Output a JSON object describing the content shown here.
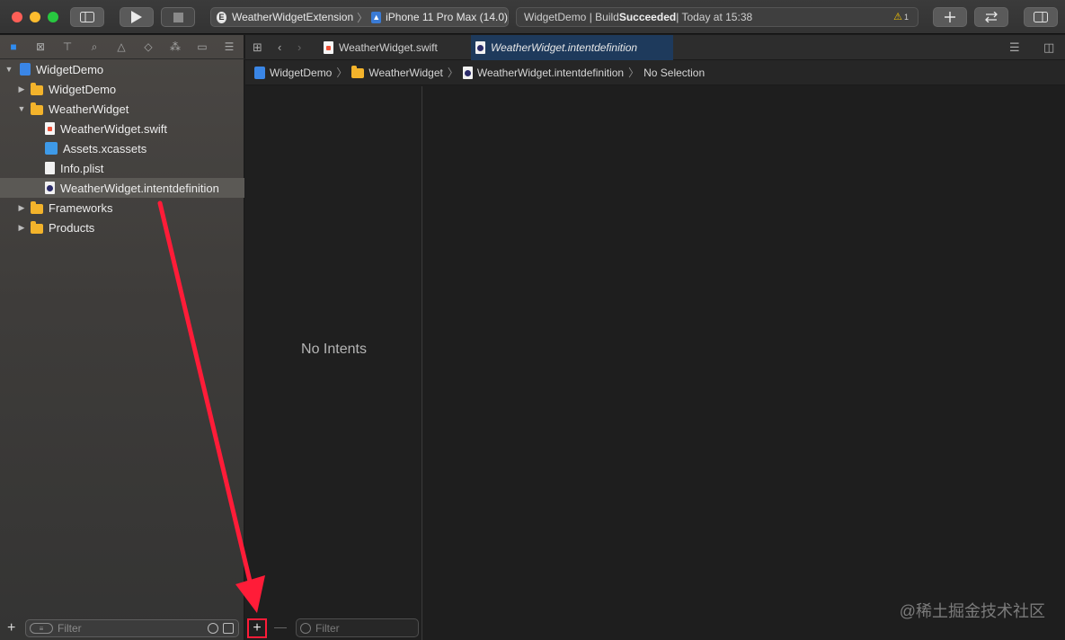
{
  "toolbar": {
    "scheme_target": "WeatherWidgetExtension",
    "scheme_badge": "E",
    "device": "iPhone 11 Pro Max (14.0)",
    "status_prefix": "WidgetDemo | Build ",
    "status_bold": "Succeeded",
    "status_suffix": " | Today at 15:38",
    "warning_count": "1"
  },
  "navigator": {
    "tree": [
      {
        "label": "WidgetDemo",
        "icon": "project-icon",
        "indent": 0,
        "expanded": true
      },
      {
        "label": "WidgetDemo",
        "icon": "folder-icon",
        "indent": 1,
        "expanded": false
      },
      {
        "label": "WeatherWidget",
        "icon": "folder-icon",
        "indent": 1,
        "expanded": true
      },
      {
        "label": "WeatherWidget.swift",
        "icon": "swift-file-icon",
        "indent": 2
      },
      {
        "label": "Assets.xcassets",
        "icon": "asset-catalog-icon",
        "indent": 2
      },
      {
        "label": "Info.plist",
        "icon": "plist-file-icon",
        "indent": 2
      },
      {
        "label": "WeatherWidget.intentdefinition",
        "icon": "intent-file-icon",
        "indent": 2,
        "selected": true
      },
      {
        "label": "Frameworks",
        "icon": "folder-icon",
        "indent": 1,
        "expanded": false
      },
      {
        "label": "Products",
        "icon": "folder-icon",
        "indent": 1,
        "expanded": false
      }
    ],
    "filter_placeholder": "Filter"
  },
  "editor": {
    "tabs": [
      {
        "label": "WeatherWidget.swift"
      },
      {
        "label": "WeatherWidget.intentdefinition"
      }
    ],
    "breadcrumb": [
      "WidgetDemo",
      "WeatherWidget",
      "WeatherWidget.intentdefinition",
      "No Selection"
    ]
  },
  "intents": {
    "empty_label": "No Intents",
    "add_label": "+",
    "remove_label": "—",
    "filter_placeholder": "Filter"
  },
  "watermark": "@稀土掘金技术社区",
  "colors": {
    "accent": "#2f8cf0",
    "highlight_box": "#ff1c38",
    "arrow": "#ff1c38",
    "selected_tab": "#1e3a5c"
  }
}
